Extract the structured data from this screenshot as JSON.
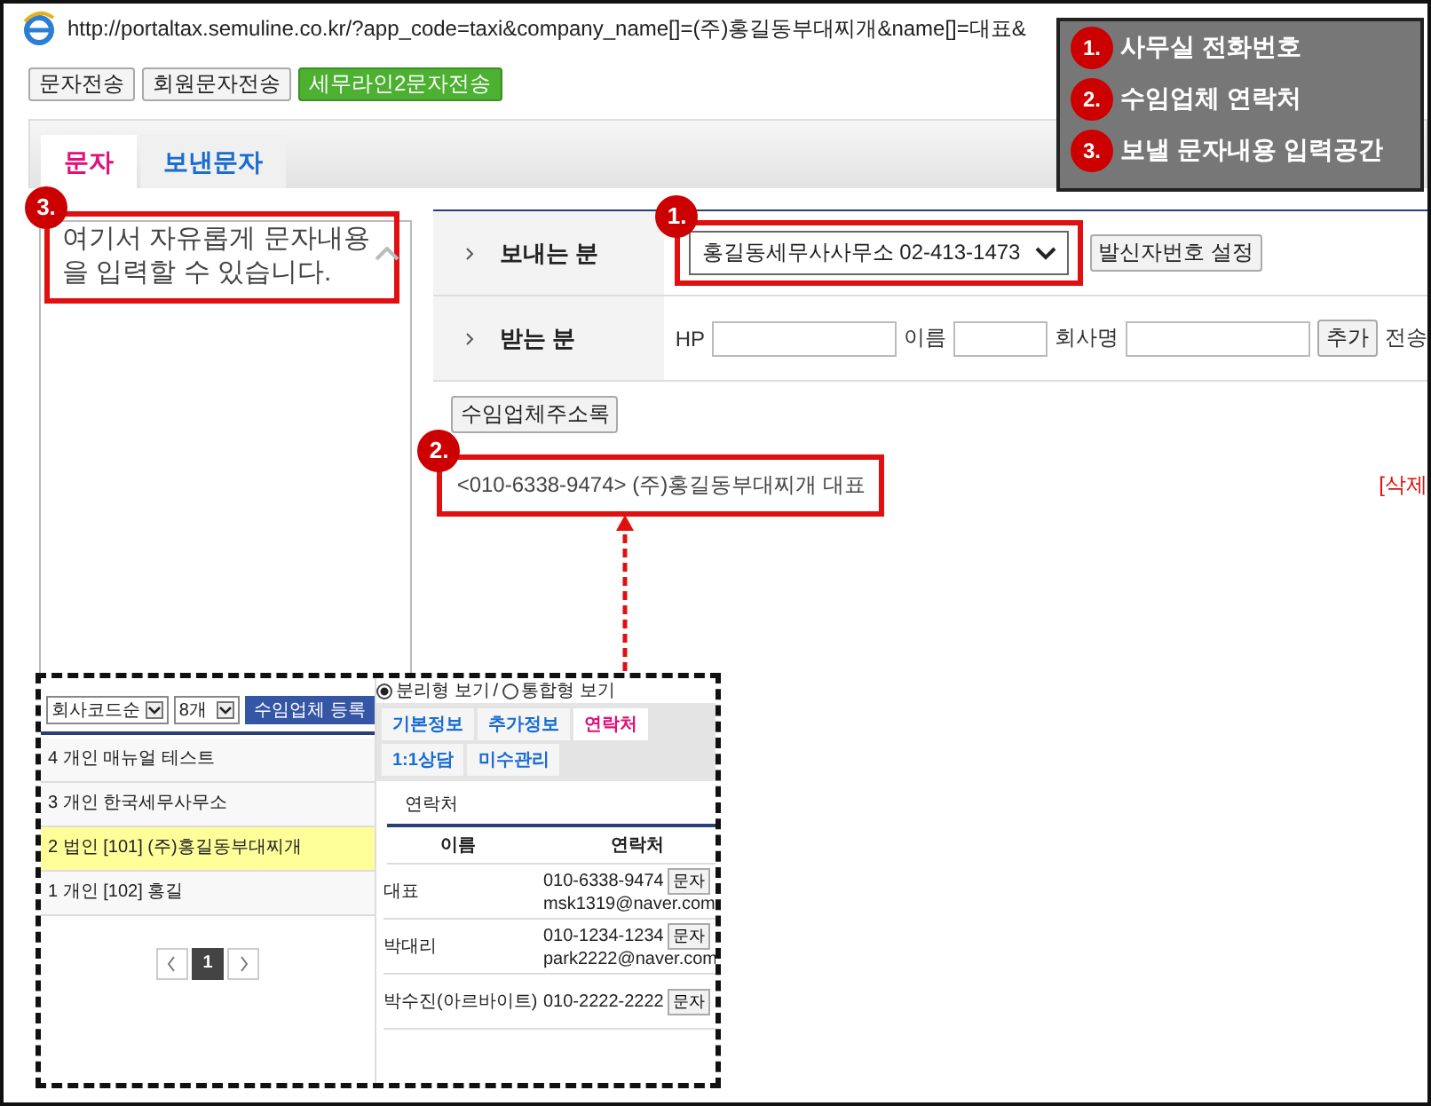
{
  "browser": {
    "url": "http://portaltax.semuline.co.kr/?app_code=taxi&company_name[]=(주)홍길동부대찌개&name[]=대표&"
  },
  "top_buttons": [
    {
      "label": "문자전송",
      "selected": false
    },
    {
      "label": "회원문자전송",
      "selected": false
    },
    {
      "label": "세무라인2문자전송",
      "selected": true
    }
  ],
  "tabs": [
    {
      "label": "문자",
      "selected": true
    },
    {
      "label": "보낸문자",
      "selected": false
    }
  ],
  "message_box": {
    "value": "여기서 자유롭게 문자내용을 입력할 수 있습니다."
  },
  "sender": {
    "label": "보내는 분",
    "select_value": "홍길동세무사사무소 02-413-1473",
    "button": "발신자번호 설정"
  },
  "recipient": {
    "label": "받는 분",
    "fields": [
      {
        "label": "HP"
      },
      {
        "label": "이름"
      },
      {
        "label": "회사명"
      }
    ],
    "add_button": "추가",
    "trailing_text": "전송"
  },
  "address_book_button": "수임업체주소록",
  "recipient_entry": {
    "text": "<010-6338-9474> (주)홍길동부대찌개 대표",
    "delete_text": "[삭제"
  },
  "markers": [
    {
      "number": "1."
    },
    {
      "number": "2."
    },
    {
      "number": "3."
    }
  ],
  "callouts": [
    {
      "number": "1.",
      "text": "사무실 전화번호"
    },
    {
      "number": "2.",
      "text": "수임업체 연락처"
    },
    {
      "number": "3.",
      "text": "보낼 문자내용 입력공간"
    }
  ],
  "inset": {
    "sort_select": "회사코드순",
    "count_select": "8개",
    "register_button": "수임업체 등록",
    "companies": [
      {
        "text": "4 개인 매뉴얼 테스트",
        "selected": false
      },
      {
        "text": "3 개인 한국세무사무소",
        "selected": false
      },
      {
        "text": "2 법인 [101] (주)홍길동부대찌개",
        "selected": true
      },
      {
        "text": "1 개인 [102] 홍길",
        "selected": false
      }
    ],
    "page": "1",
    "view_options": [
      {
        "label": "분리형 보기",
        "selected": true
      },
      {
        "label": "통합형 보기",
        "selected": false
      }
    ],
    "view_separator": "/",
    "tabs": [
      {
        "label": "기본정보",
        "selected": false
      },
      {
        "label": "추가정보",
        "selected": false
      },
      {
        "label": "연락처",
        "selected": true
      },
      {
        "label": "1:1상담",
        "selected": false
      },
      {
        "label": "미수관리",
        "selected": false
      }
    ],
    "section_title": "연락처",
    "columns": [
      "이름",
      "연락처"
    ],
    "contacts": [
      {
        "name": "대표",
        "phone": "010-6338-9474",
        "sms_button": "문자",
        "email": "msk1319@naver.com"
      },
      {
        "name": "박대리",
        "phone": "010-1234-1234",
        "sms_button": "문자",
        "email": "park2222@naver.com"
      },
      {
        "name": "박수진(아르바이트)",
        "phone": "010-2222-2222",
        "sms_button": "문자"
      }
    ]
  }
}
